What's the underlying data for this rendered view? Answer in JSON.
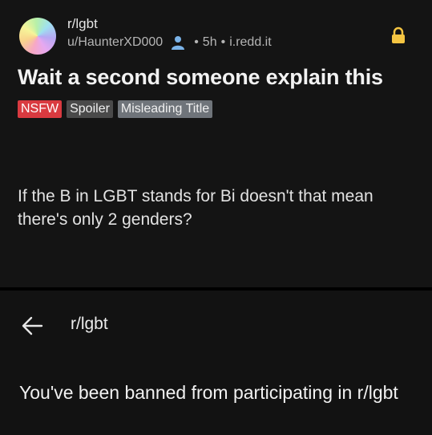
{
  "post": {
    "subreddit": "r/lgbt",
    "author": "u/HaunterXD000",
    "age": "5h",
    "domain": "i.redd.it",
    "separator": "•",
    "title": "Wait a second someone explain this",
    "tags": {
      "nsfw": "NSFW",
      "spoiler": "Spoiler",
      "flair": "Misleading Title"
    },
    "body": "If the B in LGBT stands for Bi doesn't that mean there's only 2 genders?"
  },
  "ban_screen": {
    "subreddit": "r/lgbt",
    "message": "You've been banned from participating in r/lgbt"
  },
  "colors": {
    "nsfw": "#d93a40",
    "lock": "#f5c542",
    "user_icon": "#7bb3e8"
  },
  "icons": [
    "subreddit-avatar",
    "user-icon",
    "lock-icon",
    "back-arrow-icon"
  ]
}
